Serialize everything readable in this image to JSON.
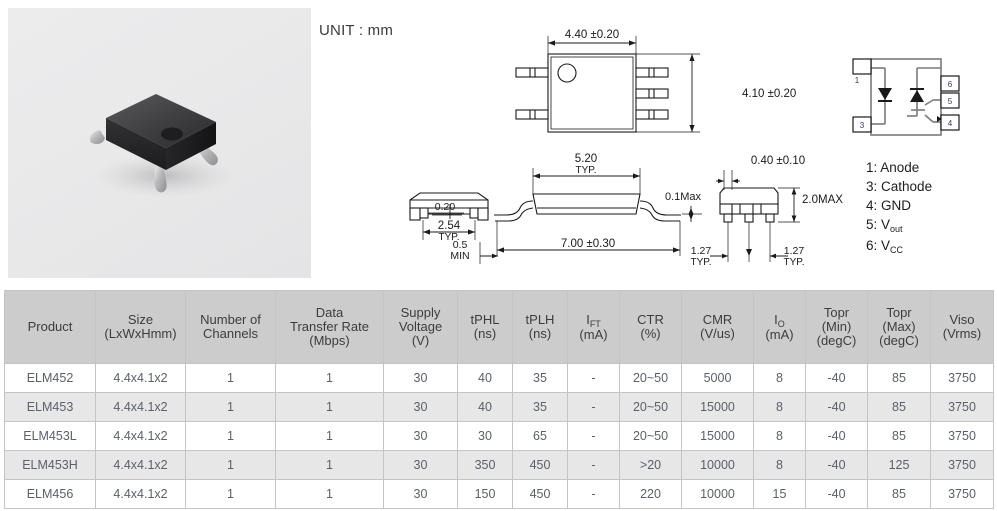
{
  "photo": {
    "alt_name": "optocoupler-sop-package-photo"
  },
  "unit_note": "UNIT : mm",
  "dimensions": {
    "top_view_width": "4.40 ±0.20",
    "top_view_height": "4.10 ±0.20",
    "side_body_width": "5.20",
    "side_body_width_tol": "TYP.",
    "lead_span": "7.00 ±0.30",
    "stand_off": "0.20",
    "stand_off_min": "0.5",
    "stand_off_min_label": "MIN",
    "coplanarity": "0.1Max",
    "lead_width": "0.40 ±0.10",
    "body_height": "2.0MAX",
    "pitch_left": "1.27",
    "pitch_left_label": "TYP.",
    "pitch_right": "1.27",
    "pitch_right_label": "TYP.",
    "front_pitch": "2.54",
    "front_pitch_label": "TYP."
  },
  "schematic": {
    "pin_boxes": [
      "1",
      "3",
      "6",
      "5",
      "4"
    ]
  },
  "pin_legend": [
    {
      "num": "1:",
      "name": "Anode",
      "sub": ""
    },
    {
      "num": "3:",
      "name": "Cathode",
      "sub": ""
    },
    {
      "num": "4:",
      "name": "GND",
      "sub": ""
    },
    {
      "num": "5:",
      "name": "V",
      "sub": "out"
    },
    {
      "num": "6:",
      "name": "V",
      "sub": "CC"
    }
  ],
  "table": {
    "columns": [
      {
        "lines": [
          "Product"
        ]
      },
      {
        "lines": [
          "Size",
          "(LxWxHmm)"
        ]
      },
      {
        "lines": [
          "Number of",
          "Channels"
        ]
      },
      {
        "lines": [
          "Data",
          "Transfer Rate",
          "(Mbps)"
        ]
      },
      {
        "lines": [
          "Supply",
          "Voltage",
          "(V)"
        ]
      },
      {
        "lines": [
          "tPHL",
          "(ns)"
        ]
      },
      {
        "lines": [
          "tPLH",
          "(ns)"
        ]
      },
      {
        "lines": [
          "I",
          "(mA)"
        ],
        "sub": "FT"
      },
      {
        "lines": [
          "CTR",
          "(%)"
        ]
      },
      {
        "lines": [
          "CMR",
          "(V/us)"
        ]
      },
      {
        "lines": [
          "I",
          "(mA)"
        ],
        "sub": "O"
      },
      {
        "lines": [
          "Topr",
          "(Min)",
          "(degC)"
        ]
      },
      {
        "lines": [
          "Topr",
          "(Max)",
          "(degC)"
        ]
      },
      {
        "lines": [
          "Viso",
          "(Vrms)"
        ]
      }
    ],
    "rows": [
      [
        "ELM452",
        "4.4x4.1x2",
        "1",
        "1",
        "30",
        "40",
        "35",
        "-",
        "20~50",
        "5000",
        "8",
        "-40",
        "85",
        "3750"
      ],
      [
        "ELM453",
        "4.4x4.1x2",
        "1",
        "1",
        "30",
        "40",
        "35",
        "-",
        "20~50",
        "15000",
        "8",
        "-40",
        "85",
        "3750"
      ],
      [
        "ELM453L",
        "4.4x4.1x2",
        "1",
        "1",
        "30",
        "30",
        "65",
        "-",
        "20~50",
        "15000",
        "8",
        "-40",
        "85",
        "3750"
      ],
      [
        "ELM453H",
        "4.4x4.1x2",
        "1",
        "1",
        "30",
        "350",
        "450",
        "-",
        ">20",
        "10000",
        "8",
        "-40",
        "125",
        "3750"
      ],
      [
        "ELM456",
        "4.4x4.1x2",
        "1",
        "1",
        "30",
        "150",
        "450",
        "-",
        "220",
        "10000",
        "15",
        "-40",
        "85",
        "3750"
      ]
    ]
  },
  "colors": {
    "header_bg": "#cccccc",
    "row_alt_bg": "#e7e7e7",
    "row_bg": "#ffffff",
    "border": "#c4c4c4",
    "text": "#5a5f6a",
    "photo_bg": "#e9e9ea"
  }
}
